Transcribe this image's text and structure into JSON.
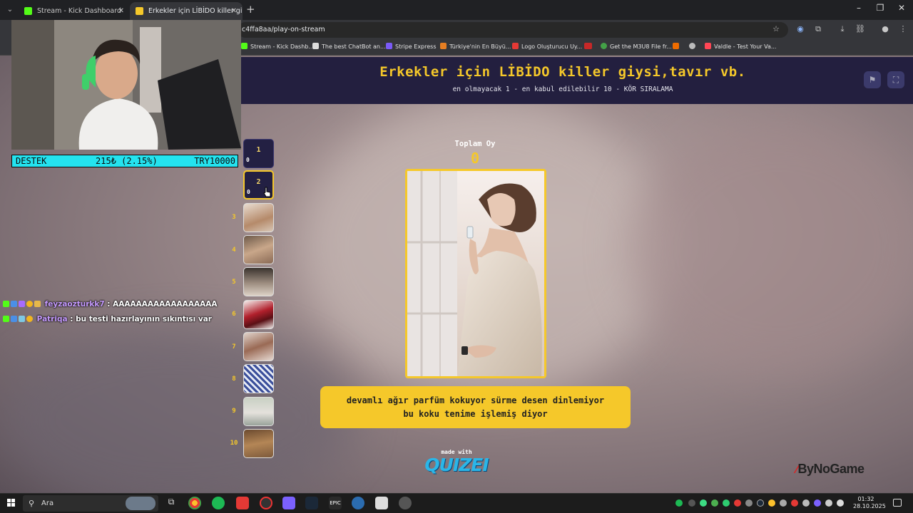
{
  "browser": {
    "tabs": [
      {
        "label": "Stream - Kick Dashboard",
        "active": false
      },
      {
        "label": "Erkekler için LİBİDO killer giysi,tavır vb.",
        "active": true
      }
    ],
    "url": "c4ffa8aa/play-on-stream",
    "bookmarks": [
      "Stream - Kick Dashb...",
      "The best ChatBot an...",
      "Stripe Express",
      "Türkiye'nin En Büyü...",
      "Logo Oluşturucu Uy...",
      "Get the M3U8 File fr...",
      "Valdle - Test Your Va..."
    ]
  },
  "quiz": {
    "title": "Erkekler için LİBİDO killer giysi,tavır vb.",
    "subtitle": "en olmayacak 1 - en kabul edilebilir 10 - KÖR SIRALAMA",
    "vote_label": "Toplam Oy",
    "vote_count": "0",
    "caption": "devamlı ağır parfüm kokuyor sürme desen dinlemiyor bu koku tenime işlemiş diyor",
    "slots": [
      {
        "rank": "1",
        "count": "0"
      },
      {
        "rank": "2",
        "count": "0"
      },
      {
        "rank": "3"
      },
      {
        "rank": "4"
      },
      {
        "rank": "5"
      },
      {
        "rank": "6"
      },
      {
        "rank": "7"
      },
      {
        "rank": "8"
      },
      {
        "rank": "9"
      },
      {
        "rank": "10"
      }
    ],
    "made_with": "made with",
    "brand": "QUIZEI",
    "sponsor": "ByNoGame"
  },
  "overlay": {
    "donation_label": "DESTEK",
    "donation_progress": "215₺ (2.15%)",
    "donation_progress_fraction": 0.0215,
    "donation_goal": "TRY10000",
    "chat": [
      {
        "user": "feyzaozturkk7",
        "sep": " : ",
        "message": "AAAAAAAAAAAAAAAAAA"
      },
      {
        "user": "Patriqa",
        "sep": " : ",
        "message": "bu testi hazırlayının sıkıntısı var"
      }
    ]
  },
  "taskbar": {
    "search_placeholder": "Ara",
    "time": "01:32",
    "date": "28.10.2025"
  },
  "colors": {
    "accent": "#f5c82a",
    "header_bg": "#231f3f",
    "donation_bar": "#24e3ef",
    "chat_user": "#c69bff"
  }
}
